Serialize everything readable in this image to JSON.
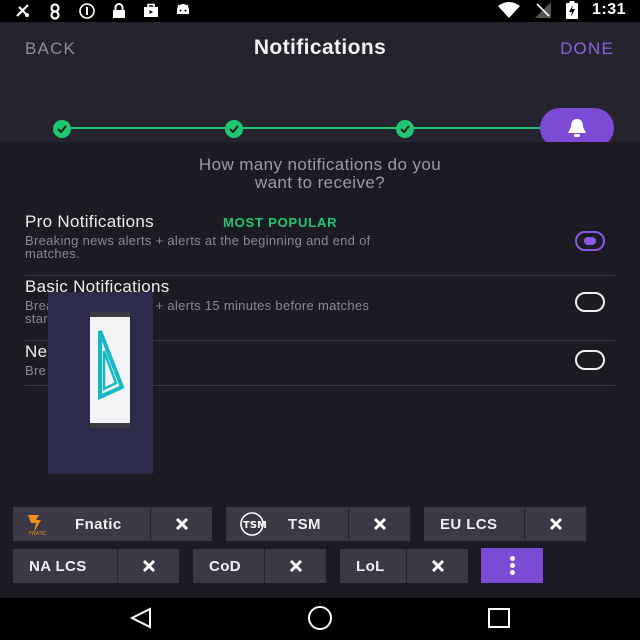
{
  "status_bar": {
    "time": "1:31",
    "left_icons": [
      "fa-notification-icon",
      "link-icon",
      "info-icon",
      "lock-icon",
      "briefcase-icon",
      "android-icon"
    ],
    "right_icons": [
      "wifi-icon",
      "signal-icon",
      "battery-icon"
    ]
  },
  "header": {
    "back_label": "BACK",
    "title": "Notifications",
    "done_label": "DONE"
  },
  "stepper": {
    "completed_steps": 3,
    "active_step_icon": "bell-icon"
  },
  "question": {
    "line1": "How many notifications do you",
    "line2": "want to receive?"
  },
  "options": [
    {
      "title": "Pro Notifications",
      "badge": "MOST POPULAR",
      "desc_line1": "Breaking news alerts + alerts at the beginning and end of",
      "desc_line2": "matches.",
      "selected": true
    },
    {
      "title": "Basic Notifications",
      "badge": "",
      "desc_line1": "Breaking news alerts + alerts 15 minutes before matches",
      "desc_line2": "start.",
      "selected": false
    },
    {
      "title": "Ne",
      "badge": "",
      "desc_line1": "Bre                alerts only.",
      "desc_line2": "",
      "selected": false
    }
  ],
  "chips": [
    {
      "label": "Fnatic",
      "icon": "fnatic-logo-icon"
    },
    {
      "label": "TSM",
      "icon": "tsm-logo-icon"
    },
    {
      "label": "EU LCS",
      "icon": ""
    },
    {
      "label": "NA LCS",
      "icon": ""
    },
    {
      "label": "CoD",
      "icon": ""
    },
    {
      "label": "LoL",
      "icon": ""
    }
  ],
  "colors": {
    "accent_purple": "#7b4bd6",
    "accent_green": "#1fc870",
    "background": "#1c1b24",
    "header_bg": "#24232e",
    "chip_bg": "#3a3945"
  }
}
